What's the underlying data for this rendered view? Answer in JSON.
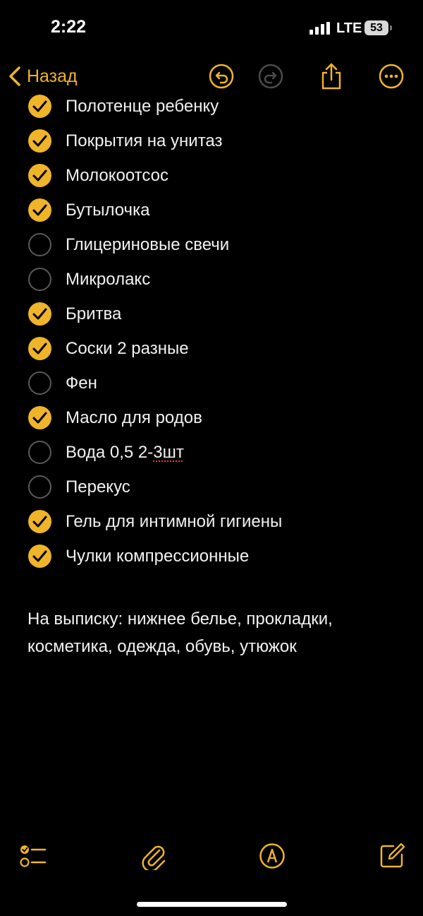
{
  "status_bar": {
    "time": "2:22",
    "network": "LTE",
    "battery": "53"
  },
  "nav": {
    "back_label": "Назад",
    "icons": [
      "chevron-left-icon",
      "undo-icon",
      "redo-icon",
      "share-icon",
      "more-icon"
    ]
  },
  "accent_color": "#f0b429",
  "checklist": [
    {
      "label": "Полотенце ребенку",
      "checked": true
    },
    {
      "label": "Покрытия на унитаз",
      "checked": true
    },
    {
      "label": "Молокоотсос",
      "checked": true
    },
    {
      "label": "Бутылочка",
      "checked": true
    },
    {
      "label": "Глицериновые свечи",
      "checked": false
    },
    {
      "label": "Микролакс",
      "checked": false
    },
    {
      "label": "Бритва",
      "checked": true
    },
    {
      "label": "Соски 2 разные",
      "checked": true
    },
    {
      "label": "Фен",
      "checked": false
    },
    {
      "label": "Масло для родов",
      "checked": true
    },
    {
      "label": "Вода 0,5 2-",
      "label_misspelled": "3шт",
      "checked": false
    },
    {
      "label": "Перекус",
      "checked": false
    },
    {
      "label": "Гель для интимной гигиены",
      "checked": true
    },
    {
      "label": "Чулки компрессионные",
      "checked": true
    }
  ],
  "note_text": "На выписку: нижнее белье, прокладки, косметика, одежда, обувь, утюжок",
  "toolbar": {
    "icons": [
      "checklist-icon",
      "attachment-icon",
      "markup-icon",
      "compose-icon"
    ]
  }
}
